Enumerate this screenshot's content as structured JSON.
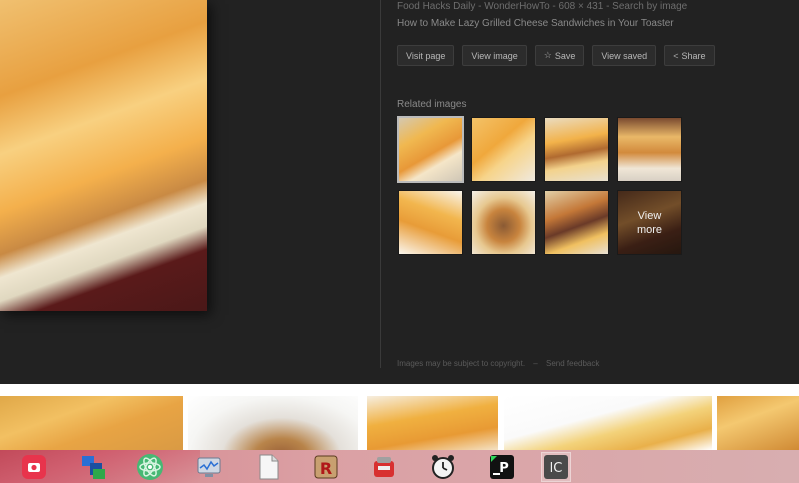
{
  "preview": {
    "source_line": "Food Hacks Daily - WonderHowTo - 608 × 431 - Search by image",
    "title": "How to Make Lazy Grilled Cheese Sandwiches in Your Toaster",
    "buttons": [
      {
        "label": "Visit page",
        "icon": ""
      },
      {
        "label": "View image",
        "icon": ""
      },
      {
        "label": "Save",
        "icon": "star-icon"
      },
      {
        "label": "View saved",
        "icon": ""
      },
      {
        "label": "Share",
        "icon": "share-icon"
      }
    ],
    "related_title": "Related images",
    "view_more_label": "View more",
    "footer": {
      "copyright_note": "Images may be subject to copyright.",
      "feedback_link": "Send feedback"
    }
  },
  "taskbar": {
    "apps": [
      {
        "name": "screen-recorder-icon"
      },
      {
        "name": "network-manager-icon"
      },
      {
        "name": "atom-editor-icon"
      },
      {
        "name": "system-monitor-icon"
      },
      {
        "name": "document-viewer-icon"
      },
      {
        "name": "app-r-icon"
      },
      {
        "name": "backup-app-icon"
      },
      {
        "name": "alarm-clock-icon"
      },
      {
        "name": "ide-terminal-icon"
      },
      {
        "name": "lc-app-icon"
      }
    ]
  },
  "colors": {
    "panel_bg": "#222222",
    "button_bg": "#2c2c2c",
    "taskbar_bg": "#d89aa0"
  }
}
